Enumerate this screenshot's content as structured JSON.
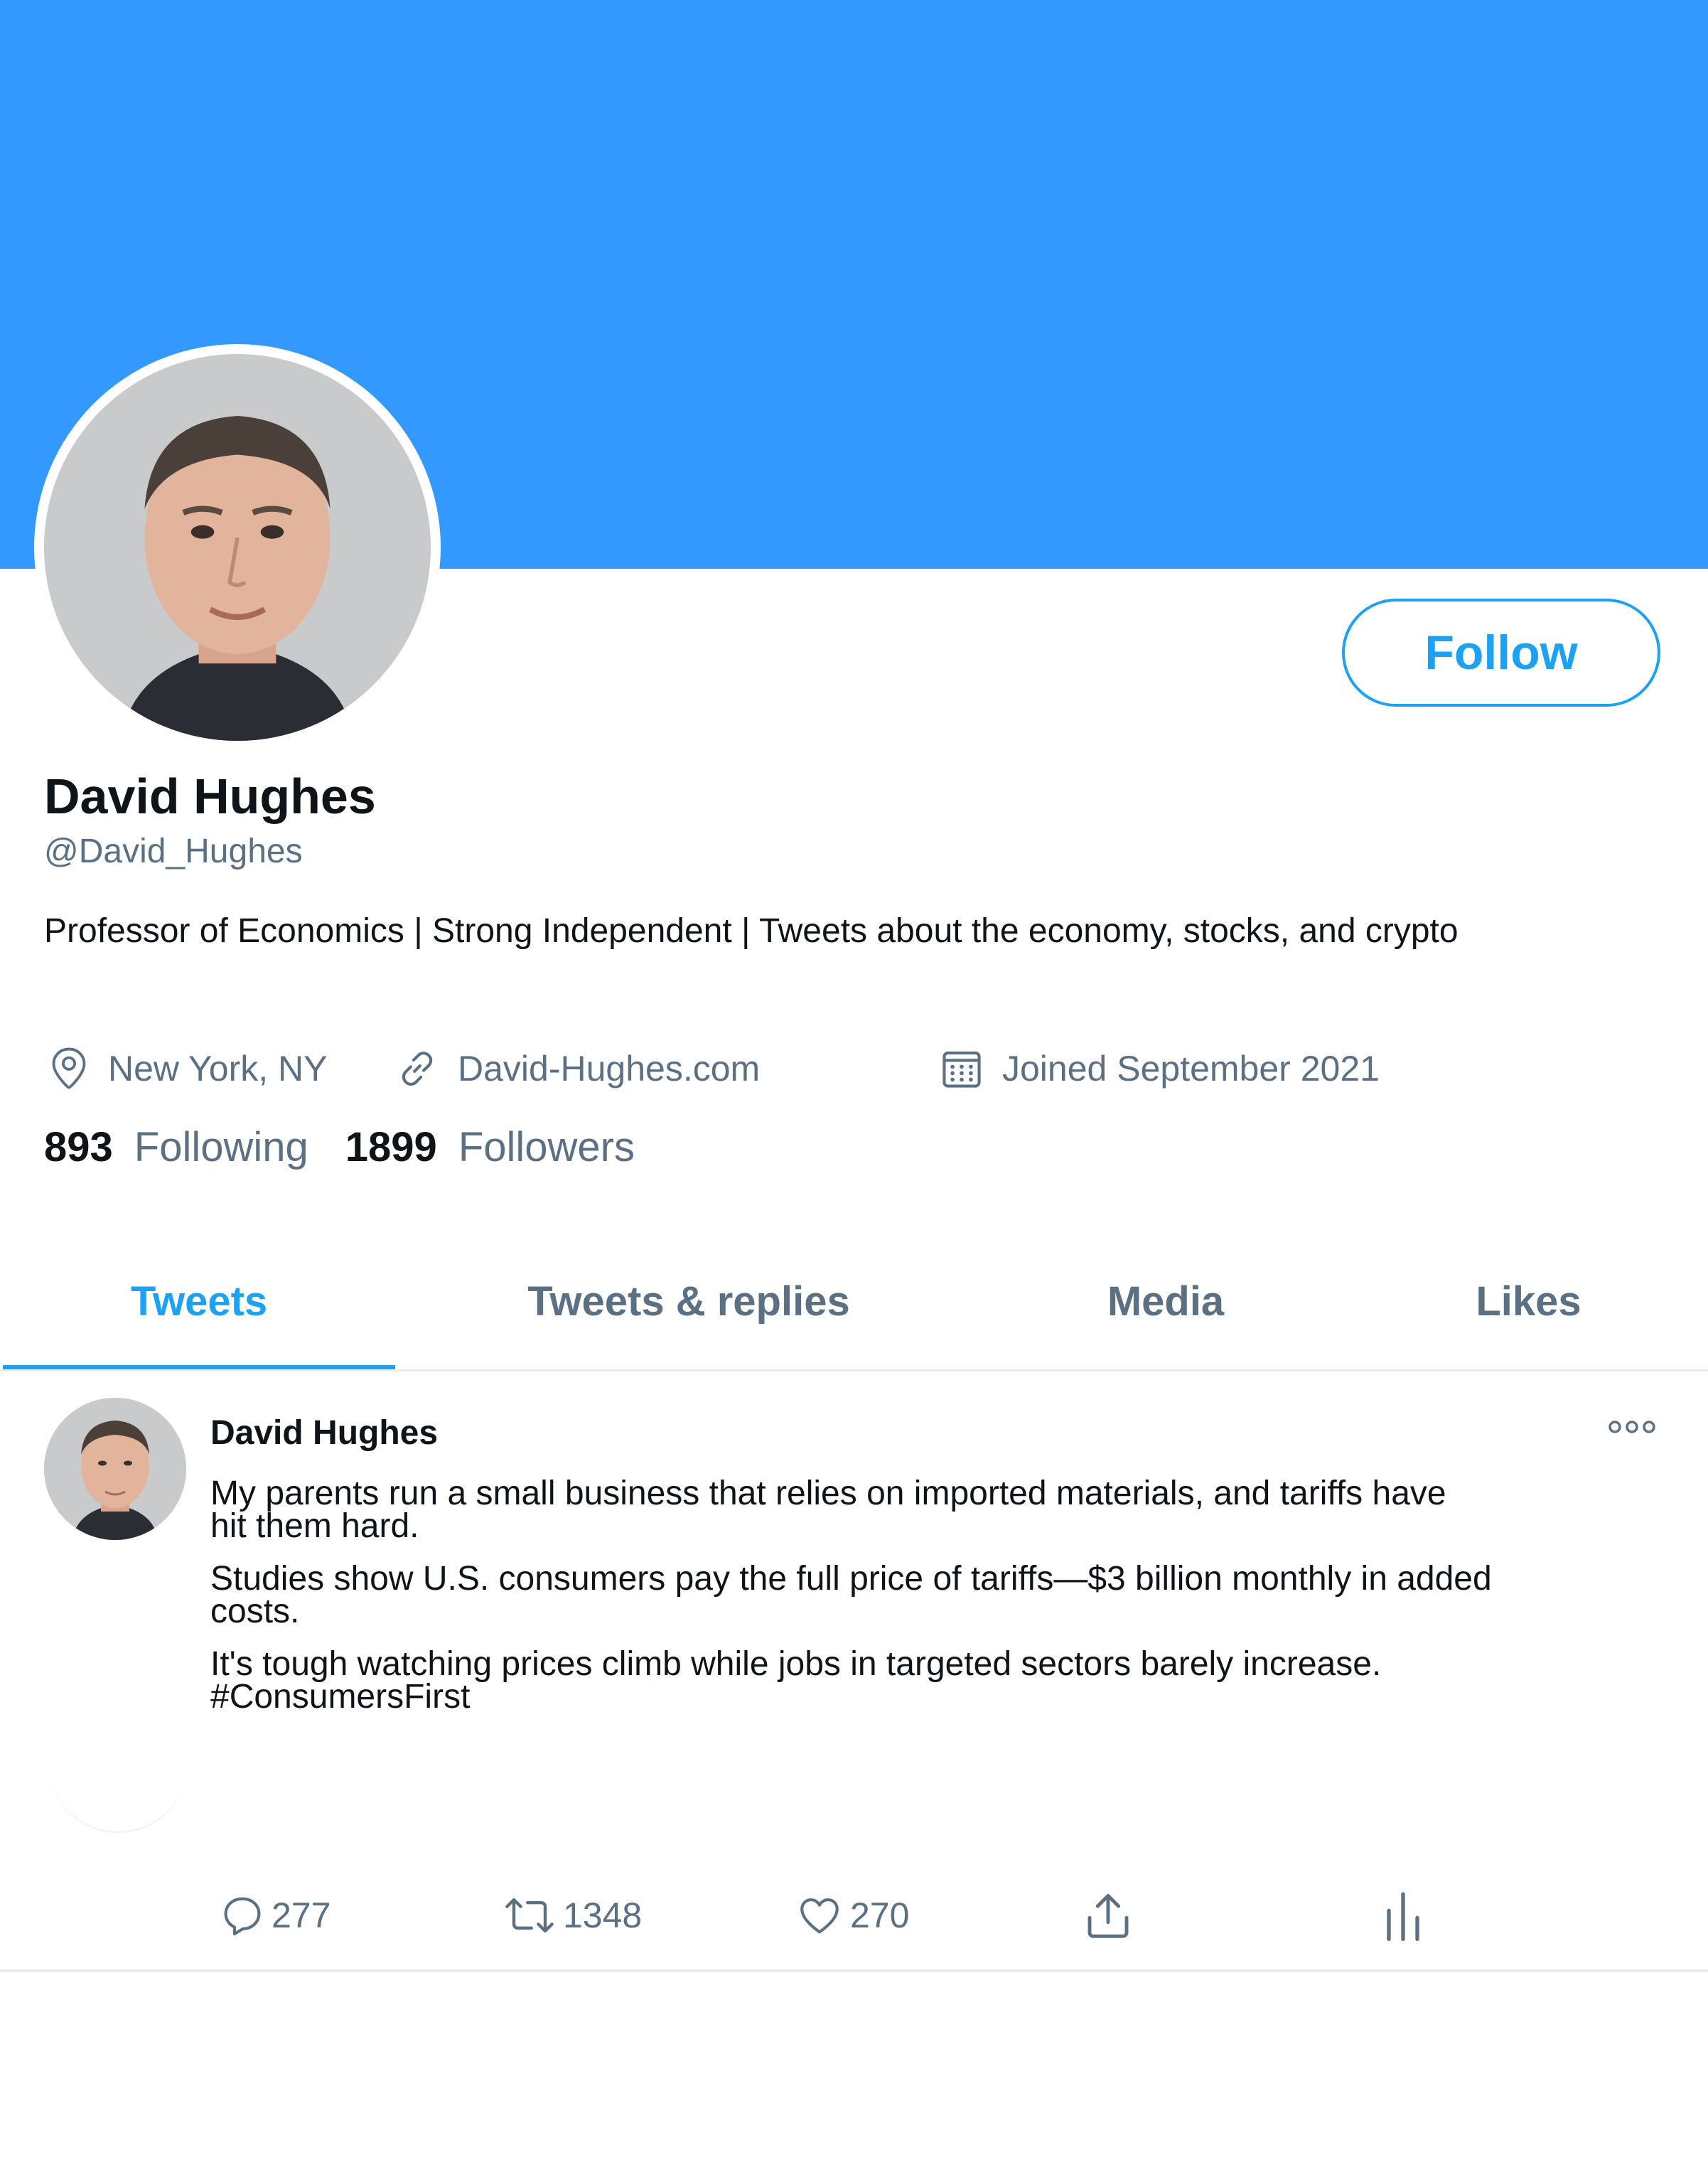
{
  "profile": {
    "display_name": "David Hughes",
    "handle": "@David_Hughes",
    "bio": "Professor of Economics | Strong Independent | Tweets about the economy, stocks, and crypto",
    "location": "New York, NY",
    "website": "David-Hughes.com",
    "joined": "Joined September 2021",
    "following_count": "893",
    "following_label": "Following",
    "followers_count": "1899",
    "followers_label": "Followers",
    "follow_button_label": "Follow",
    "banner_color": "#3399ff",
    "accent_color": "#1da1f2"
  },
  "tabs": [
    {
      "label": "Tweets",
      "active": true
    },
    {
      "label": "Tweets & replies",
      "active": false
    },
    {
      "label": "Media",
      "active": false
    },
    {
      "label": "Likes",
      "active": false
    }
  ],
  "tweet": {
    "author": "David Hughes",
    "lines": [
      "My parents run a small business that relies on imported materials, and tariffs have hit them hard.",
      "Studies show U.S. consumers pay the full price of tariffs—$3 billion monthly in added costs.",
      "It's tough watching prices climb while jobs in targeted sectors barely increase. #ConsumersFirst"
    ],
    "line_parts": [
      [
        "My parents run a small business that relies on imported materials, and tariffs have",
        "hit them hard."
      ],
      [
        "Studies show U.S. consumers pay the full price of tariffs—$3 billion monthly in added",
        "costs."
      ],
      [
        "It's tough watching prices climb while jobs in targeted sectors barely increase.",
        "#ConsumersFirst"
      ]
    ],
    "replies": "277",
    "retweets": "1348",
    "likes": "270",
    "icons": [
      "reply-icon",
      "retweet-icon",
      "like-icon",
      "share-icon",
      "analytics-icon",
      "more-icon"
    ]
  },
  "meta_icons": [
    "location-pin-icon",
    "link-icon",
    "calendar-icon"
  ]
}
